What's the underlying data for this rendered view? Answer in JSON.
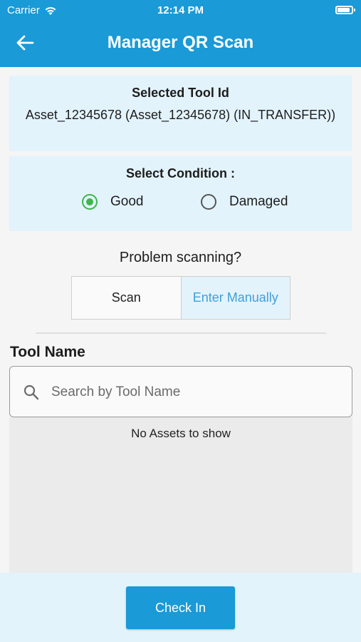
{
  "status_bar": {
    "carrier": "Carrier",
    "time": "12:14 PM"
  },
  "header": {
    "title": "Manager QR Scan",
    "back_icon": "arrow-left-icon"
  },
  "selected_tool": {
    "heading": "Selected Tool Id",
    "value": "Asset_12345678 (Asset_12345678) (IN_TRANSFER))"
  },
  "condition": {
    "heading": "Select Condition :",
    "options": [
      {
        "label": "Good",
        "selected": true
      },
      {
        "label": "Damaged",
        "selected": false
      }
    ]
  },
  "problem": {
    "text": "Problem scanning?",
    "tabs": [
      {
        "label": "Scan",
        "active": false
      },
      {
        "label": "Enter Manually",
        "active": true
      }
    ]
  },
  "tool_search": {
    "label": "Tool Name",
    "placeholder": "Search by Tool Name",
    "value": "",
    "icon": "search-icon",
    "empty_text": "No Assets to show"
  },
  "footer": {
    "check_in_label": "Check In"
  },
  "colors": {
    "primary": "#1a9ad6",
    "card_bg": "#e3f3fc",
    "radio_selected": "#3db64c",
    "active_tab_text": "#3f9fd9"
  }
}
